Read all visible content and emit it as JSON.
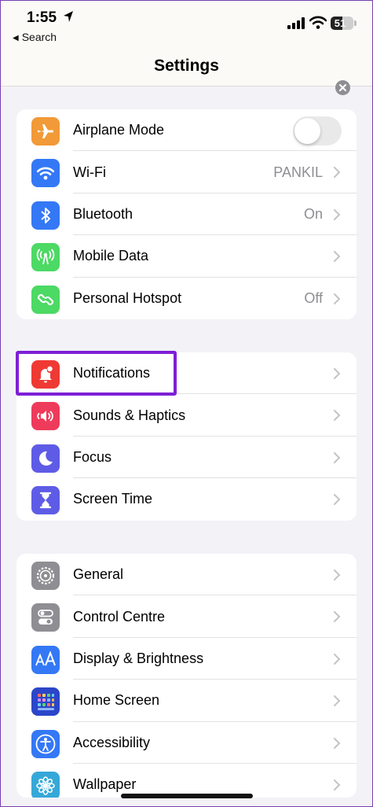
{
  "status": {
    "time": "1:55",
    "back_label": "Search",
    "battery": "51"
  },
  "nav": {
    "title": "Settings"
  },
  "groups": [
    {
      "rows": [
        {
          "label": "Airplane Mode",
          "icon": "airplane-icon",
          "color": "#f19a37",
          "control": "toggle",
          "value": ""
        },
        {
          "label": "Wi-Fi",
          "icon": "wifi-icon",
          "color": "#3478f6",
          "value": "PANKIL"
        },
        {
          "label": "Bluetooth",
          "icon": "bluetooth-icon",
          "color": "#3478f6",
          "value": "On"
        },
        {
          "label": "Mobile Data",
          "icon": "antenna-icon",
          "color": "#4cd964",
          "value": ""
        },
        {
          "label": "Personal Hotspot",
          "icon": "hotspot-icon",
          "color": "#4cd964",
          "value": "Off"
        }
      ]
    },
    {
      "rows": [
        {
          "label": "Notifications",
          "icon": "bell-icon",
          "color": "#ef3a34",
          "value": ""
        },
        {
          "label": "Sounds & Haptics",
          "icon": "speaker-icon",
          "color": "#ee3b5b",
          "value": ""
        },
        {
          "label": "Focus",
          "icon": "moon-icon",
          "color": "#5e5ce6",
          "value": ""
        },
        {
          "label": "Screen Time",
          "icon": "hourglass-icon",
          "color": "#5e5ce6",
          "value": ""
        }
      ]
    },
    {
      "rows": [
        {
          "label": "General",
          "icon": "gear-icon",
          "color": "#8e8e93",
          "value": ""
        },
        {
          "label": "Control Centre",
          "icon": "switches-icon",
          "color": "#8e8e93",
          "value": ""
        },
        {
          "label": "Display & Brightness",
          "icon": "text-size-icon",
          "color": "#3478f6",
          "value": ""
        },
        {
          "label": "Home Screen",
          "icon": "grid-icon",
          "color": "#2c46c9",
          "value": ""
        },
        {
          "label": "Accessibility",
          "icon": "accessibility-icon",
          "color": "#3478f6",
          "value": ""
        },
        {
          "label": "Wallpaper",
          "icon": "flower-icon",
          "color": "#36a8d8",
          "value": ""
        }
      ]
    }
  ]
}
